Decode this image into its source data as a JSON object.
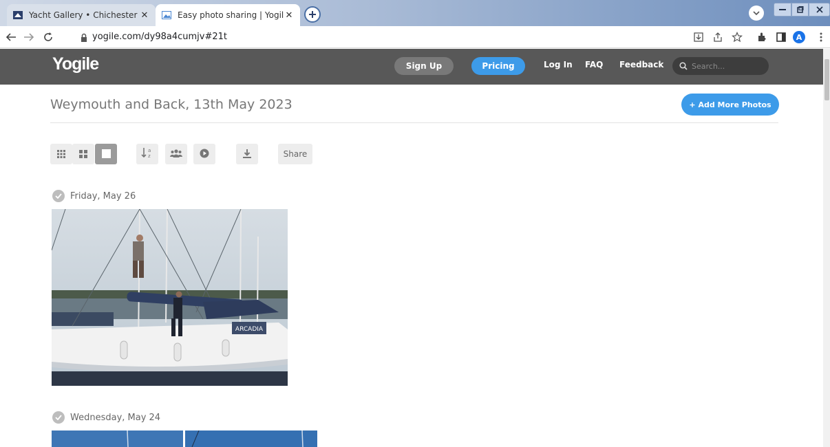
{
  "browser": {
    "tabs": [
      {
        "title": "Yacht Gallery • Chichester Yacht C",
        "icon": "yacht-flag-icon"
      },
      {
        "title": "Easy photo sharing | Yogile",
        "icon": "photo-icon"
      }
    ],
    "url": "yogile.com/dy98a4cumjv#21t",
    "profile_initial": "A"
  },
  "header": {
    "logo": "Yogile",
    "signup": "Sign Up",
    "pricing": "Pricing",
    "login": "Log In",
    "faq": "FAQ",
    "feedback": "Feedback",
    "search_placeholder": "Search..."
  },
  "album": {
    "title": "Weymouth and Back, 13th May 2023",
    "add_photos": "+ Add More Photos",
    "share": "Share",
    "groups": [
      {
        "date": "Friday, May 26",
        "boat_name": "ARCADIA"
      },
      {
        "date": "Wednesday, May 24"
      }
    ]
  },
  "colors": {
    "header_bg": "#585858",
    "accent": "#3d9be9",
    "text_muted": "#777777"
  }
}
